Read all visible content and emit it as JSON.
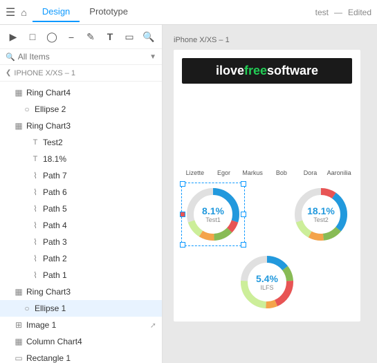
{
  "topbar": {
    "menu_icon": "☰",
    "home_icon": "⌂",
    "tabs": [
      {
        "label": "Design",
        "active": true
      },
      {
        "label": "Prototype",
        "active": false
      }
    ],
    "project": "test",
    "separator": "—",
    "status": "Edited"
  },
  "sidebar": {
    "search_placeholder": "All Items",
    "breadcrumb": "IPHONE X/XS – 1",
    "layers": [
      {
        "id": "ring-chart4",
        "label": "Ring Chart4",
        "indent": 0,
        "icon": "group"
      },
      {
        "id": "ellipse2",
        "label": "Ellipse 2",
        "indent": 1,
        "icon": "ellipse"
      },
      {
        "id": "ring-chart3a",
        "label": "Ring Chart3",
        "indent": 0,
        "icon": "group"
      },
      {
        "id": "test2",
        "label": "Test2",
        "indent": 2,
        "icon": "text"
      },
      {
        "id": "18pct",
        "label": "18.1%",
        "indent": 2,
        "icon": "text"
      },
      {
        "id": "path7",
        "label": "Path 7",
        "indent": 2,
        "icon": "path"
      },
      {
        "id": "path6",
        "label": "Path 6",
        "indent": 2,
        "icon": "path"
      },
      {
        "id": "path5",
        "label": "Path 5",
        "indent": 2,
        "icon": "path"
      },
      {
        "id": "path4",
        "label": "Path 4",
        "indent": 2,
        "icon": "path"
      },
      {
        "id": "path3",
        "label": "Path 3",
        "indent": 2,
        "icon": "path"
      },
      {
        "id": "path2",
        "label": "Path 2",
        "indent": 2,
        "icon": "path"
      },
      {
        "id": "path1",
        "label": "Path 1",
        "indent": 2,
        "icon": "path"
      },
      {
        "id": "ring-chart3b",
        "label": "Ring Chart3",
        "indent": 0,
        "icon": "group"
      },
      {
        "id": "ellipse1",
        "label": "Ellipse 1",
        "indent": 1,
        "icon": "ellipse",
        "selected": true
      },
      {
        "id": "image1",
        "label": "Image 1",
        "indent": 0,
        "icon": "image",
        "ext": true
      },
      {
        "id": "column-chart4",
        "label": "Column Chart4",
        "indent": 0,
        "icon": "group"
      },
      {
        "id": "rectangle1",
        "label": "Rectangle 1",
        "indent": 0,
        "icon": "rect"
      }
    ]
  },
  "canvas": {
    "frame_title": "iPhone X/XS – 1",
    "logo_text_black": "ilove",
    "logo_text_green": "free",
    "logo_text_black2": "software",
    "bar_labels": [
      "Lizette",
      "Egor",
      "Markus",
      "Bob",
      "Dora",
      "Aaronilia"
    ],
    "bars": [
      [
        {
          "color": "#e8734a",
          "flex": 15
        },
        {
          "color": "#f4a44a",
          "flex": 20
        },
        {
          "color": "#e85454",
          "flex": 15
        },
        {
          "color": "#88bb55",
          "flex": 25
        },
        {
          "color": "#ccee99",
          "flex": 25
        }
      ],
      [
        {
          "color": "#f4a44a",
          "flex": 10
        },
        {
          "color": "#e8734a",
          "flex": 20
        },
        {
          "color": "#e85454",
          "flex": 15
        },
        {
          "color": "#88bb55",
          "flex": 20
        },
        {
          "color": "#ccee99",
          "flex": 35
        }
      ],
      [
        {
          "color": "#e8734a",
          "flex": 12
        },
        {
          "color": "#f4c46a",
          "flex": 22
        },
        {
          "color": "#e85454",
          "flex": 18
        },
        {
          "color": "#88bb55",
          "flex": 18
        },
        {
          "color": "#ccee99",
          "flex": 30
        }
      ],
      [
        {
          "color": "#f4a44a",
          "flex": 14
        },
        {
          "color": "#e8734a",
          "flex": 16
        },
        {
          "color": "#e85454",
          "flex": 20
        },
        {
          "color": "#88bb55",
          "flex": 22
        },
        {
          "color": "#ccee99",
          "flex": 28
        }
      ],
      [
        {
          "color": "#e8734a",
          "flex": 18
        },
        {
          "color": "#f4a44a",
          "flex": 18
        },
        {
          "color": "#e85454",
          "flex": 12
        },
        {
          "color": "#88bb55",
          "flex": 24
        },
        {
          "color": "#ccee99",
          "flex": 28
        }
      ],
      [
        {
          "color": "#e8734a",
          "flex": 10
        },
        {
          "color": "#f4a44a",
          "flex": 25
        },
        {
          "color": "#e85454",
          "flex": 15
        },
        {
          "color": "#88bb55",
          "flex": 20
        },
        {
          "color": "#ccee99",
          "flex": 30
        }
      ]
    ],
    "donut1": {
      "pct": "8.1%",
      "label": "Test1",
      "selected": true
    },
    "donut2": {
      "pct": "18.1%",
      "label": "Test2",
      "selected": false
    },
    "donut3": {
      "pct": "5.4%",
      "label": "ILFS",
      "selected": false
    }
  }
}
